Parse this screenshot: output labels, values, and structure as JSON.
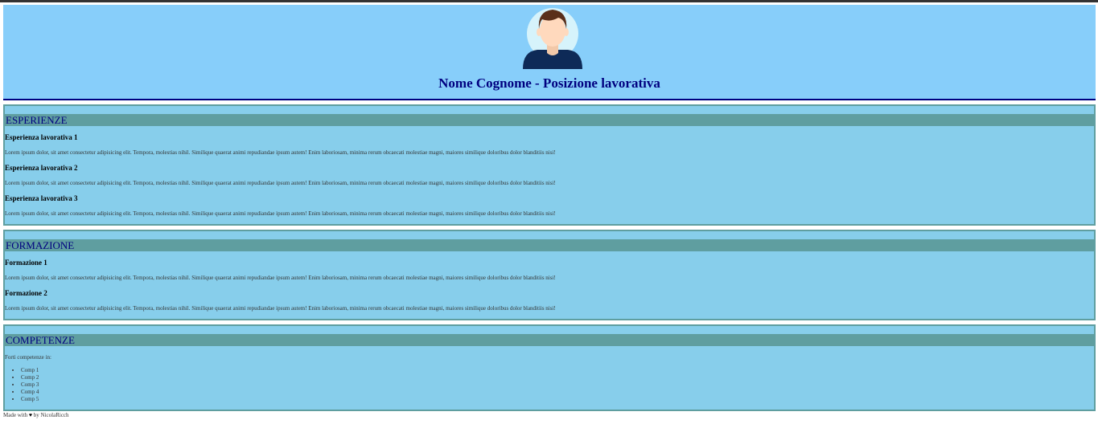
{
  "header": {
    "title": "Nome Cognome - Posizione lavorativa",
    "avatar_icon": "person-avatar-icon"
  },
  "sections": {
    "esperienze": {
      "title": "ESPERIENZE",
      "items": [
        {
          "title": "Esperienza lavorativa 1",
          "text": "Lorem ipsum dolor, sit amet consectetur adipisicing elit. Tempora, molestias nihil. Similique quaerat animi repudiandae ipsum autem! Enim laboriosam, minima rerum obcaecati molestiae magni, maiores similique doloribus dolor blanditiis nisi!"
        },
        {
          "title": "Esperienza lavorativa 2",
          "text": "Lorem ipsum dolor, sit amet consectetur adipisicing elit. Tempora, molestias nihil. Similique quaerat animi repudiandae ipsum autem! Enim laboriosam, minima rerum obcaecati molestiae magni, maiores similique doloribus dolor blanditiis nisi!"
        },
        {
          "title": "Esperienza lavorativa 3",
          "text": "Lorem ipsum dolor, sit amet consectetur adipisicing elit. Tempora, molestias nihil. Similique quaerat animi repudiandae ipsum autem! Enim laboriosam, minima rerum obcaecati molestiae magni, maiores similique doloribus dolor blanditiis nisi!"
        }
      ]
    },
    "formazione": {
      "title": "FORMAZIONE",
      "items": [
        {
          "title": "Formazione 1",
          "text": "Lorem ipsum dolor, sit amet consectetur adipisicing elit. Tempora, molestias nihil. Similique quaerat animi repudiandae ipsum autem! Enim laboriosam, minima rerum obcaecati molestiae magni, maiores similique doloribus dolor blanditiis nisi!"
        },
        {
          "title": "Formazione 2",
          "text": "Lorem ipsum dolor, sit amet consectetur adipisicing elit. Tempora, molestias nihil. Similique quaerat animi repudiandae ipsum autem! Enim laboriosam, minima rerum obcaecati molestiae magni, maiores similique doloribus dolor blanditiis nisi!"
        }
      ]
    },
    "competenze": {
      "title": "COMPETENZE",
      "intro": "Forti competenze in:",
      "items": [
        "Comp 1",
        "Comp 2",
        "Comp 3",
        "Comp 4",
        "Comp 5"
      ]
    }
  },
  "footer": {
    "prefix": "Made with",
    "heart": "♥",
    "suffix": "by NicolaRicch"
  },
  "colors": {
    "header_bg": "#87cefa",
    "title_color": "#000080",
    "section_bg": "#87ceeb",
    "section_title_bg": "#5f9ea0"
  }
}
